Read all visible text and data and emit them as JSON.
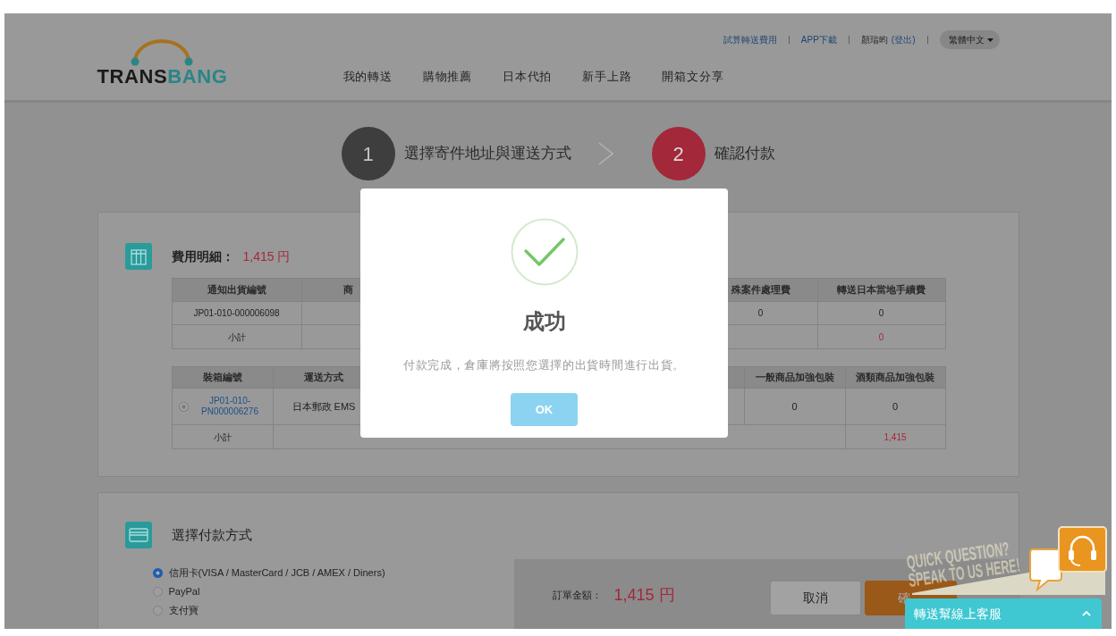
{
  "header": {
    "logo": {
      "wordmark_start": "TRANS",
      "wordmark_end": "BANG"
    },
    "top_links": [
      "試算轉送費用",
      "APP下載"
    ],
    "user": {
      "name": "顏瑞昀",
      "logout": "(登出)"
    },
    "language": "繁體中文",
    "nav": [
      "我的轉送",
      "購物推薦",
      "日本代拍",
      "新手上路",
      "開箱文分享"
    ]
  },
  "steps": [
    {
      "number": "1",
      "label": "選擇寄件地址與運送方式",
      "selected": false
    },
    {
      "number": "2",
      "label": "確認付款",
      "selected": true
    }
  ],
  "fee_card": {
    "title": "費用明細：",
    "total": "1,415 円",
    "tables": [
      {
        "columns": [
          "通知出貨編號",
          "商",
          "殊案件處理費",
          "轉送日本當地手續費"
        ],
        "rows": [
          {
            "kind": "item",
            "cells": [
              "JP01-010-000006098",
              null,
              "0",
              "0"
            ]
          },
          {
            "kind": "subtotal",
            "label": "小計",
            "value": "0"
          }
        ]
      },
      {
        "columns": [
          "裝箱編號",
          "運送方式",
          "一般商品加強包裝",
          "酒類商品加強包裝"
        ],
        "rows": [
          {
            "kind": "item",
            "cells": [
              {
                "checked": true,
                "link": "JP01-010-PN000006276"
              },
              "日本郵政 EMS",
              "0",
              "0"
            ]
          },
          {
            "kind": "subtotal",
            "label": "小計",
            "value": "1,415"
          }
        ]
      }
    ]
  },
  "payment_card": {
    "title": "選擇付款方式",
    "options": [
      {
        "label": "信用卡(VISA / MasterCard / JCB / AMEX / Diners)",
        "selected": true
      },
      {
        "label": "PayPal",
        "selected": false
      },
      {
        "label": "支付寶",
        "selected": false
      }
    ],
    "summary": {
      "label": "訂單金額：",
      "amount": "1,415 円"
    },
    "buttons": [
      {
        "kind": "secondary",
        "label": "取消"
      },
      {
        "kind": "primary",
        "label": "確"
      }
    ]
  },
  "chat": {
    "teaser": [
      "QUICK QUESTION?",
      "SPEAK TO US HERE!"
    ],
    "label": "轉送幫線上客服"
  },
  "dialog": {
    "title": "成功",
    "message": "付款完成，倉庫將按照您選擇的出貨時間進行出貨。",
    "button": "OK"
  }
}
